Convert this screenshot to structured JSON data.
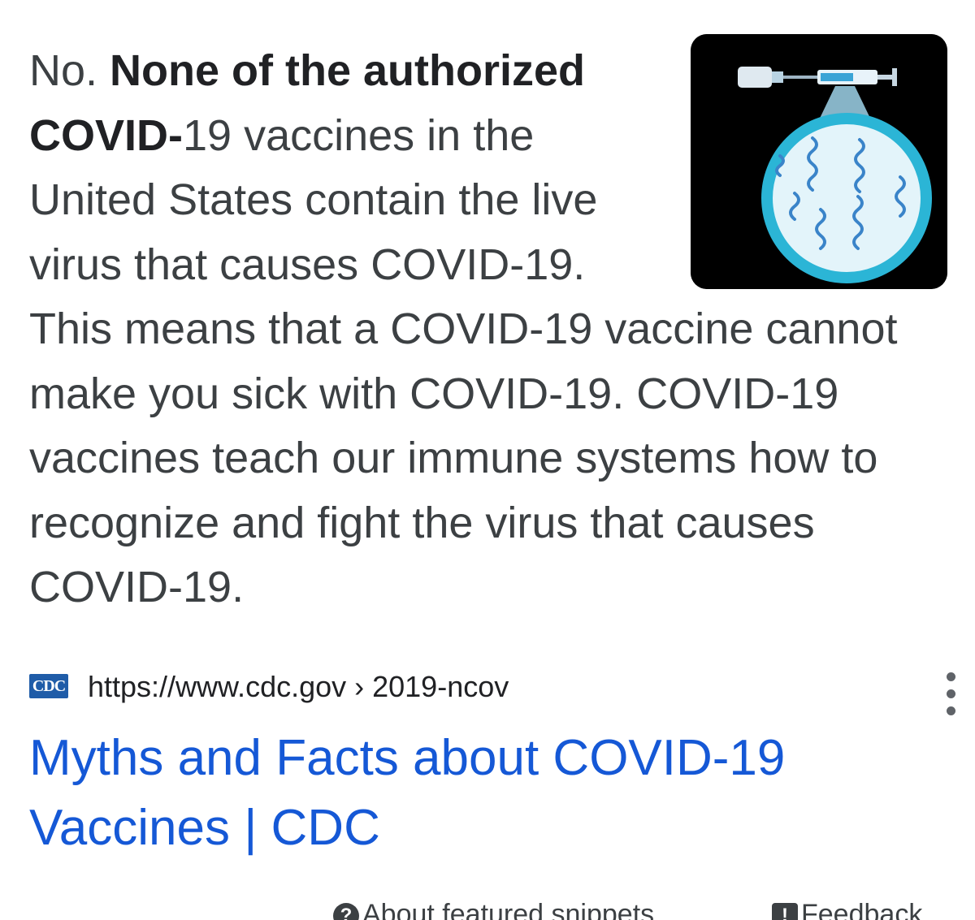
{
  "snippet": {
    "prefix": "No. ",
    "bold": "None of the authorized COVID-",
    "text": "19 vaccines in the United States contain the live virus that causes COVID-19. This means that a COVID-19 vaccine cannot make you sick with COVID-19. COVID-19 vaccines teach our immune systems how to recognize and fight the virus that causes COVID-19."
  },
  "thumbnail": {
    "icon": "vaccine-syringe-mrna-icon",
    "colors": {
      "background": "#000000",
      "circle_border": "#2bb5d6",
      "circle_fill": "#e3f4fa",
      "strand": "#3a84c9"
    }
  },
  "source": {
    "favicon_text": "CDC",
    "url": "https://www.cdc.gov › 2019-ncov",
    "menu_icon": "more-vert-icon"
  },
  "result": {
    "title": "Myths and Facts about COVID-19 Vaccines | CDC"
  },
  "footer": {
    "about": "About featured snippets",
    "feedback": "Feedback"
  },
  "colors": {
    "link": "#1558d6",
    "text": "#3c4043",
    "favicon_bg": "#1f5ca8"
  }
}
